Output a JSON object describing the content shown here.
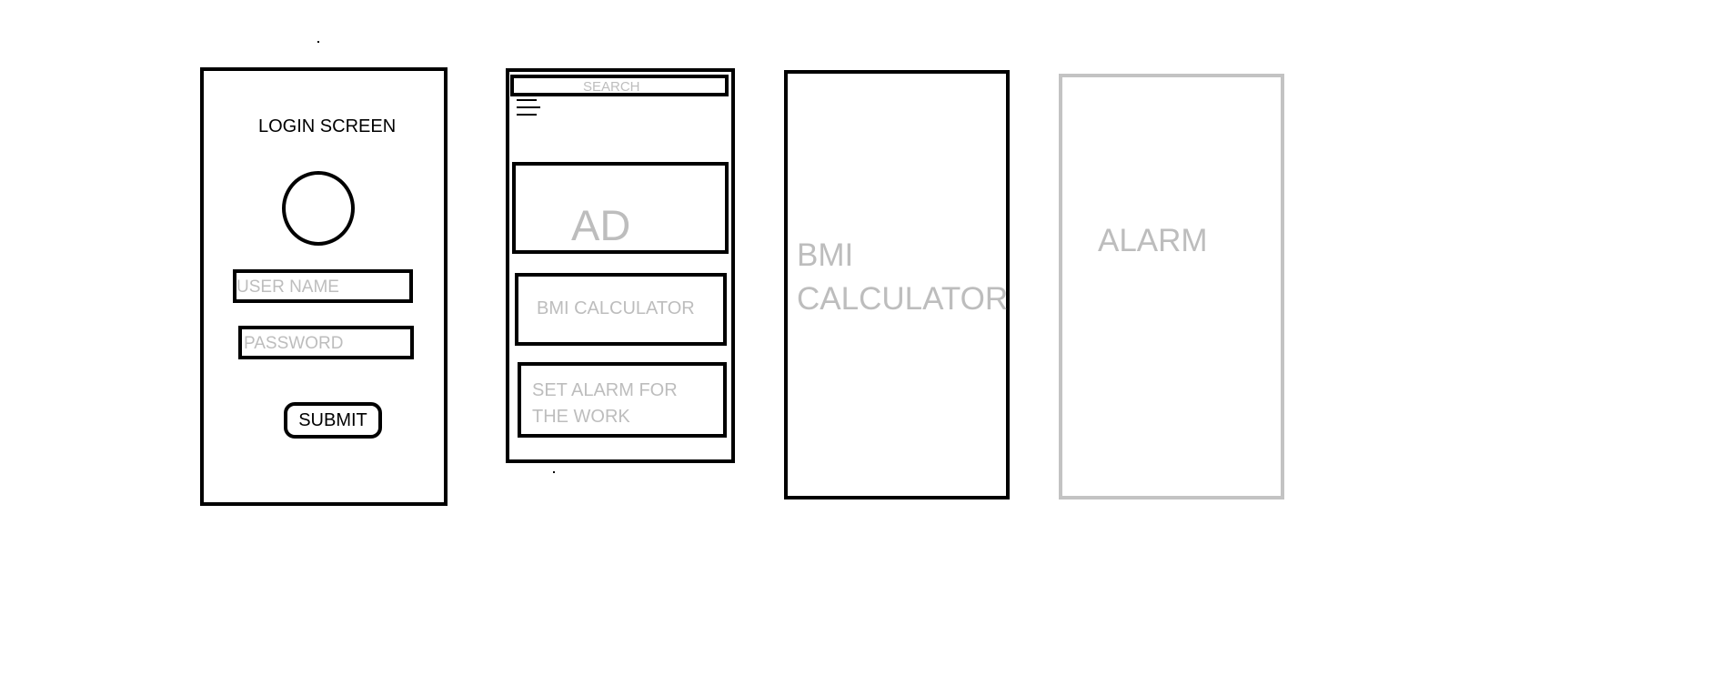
{
  "login_screen": {
    "title": "LOGIN SCREEN",
    "username_placeholder": "USER NAME",
    "password_placeholder": "PASSWORD",
    "submit_label": "SUBMIT"
  },
  "home_screen": {
    "search_placeholder": "SEARCH",
    "menu_icon": "hamburger-menu-icon",
    "ad_label": "AD",
    "bmi_card_label": "BMI CALCULATOR",
    "alarm_card_line1": "SET ALARM FOR",
    "alarm_card_line2": "THE WORK"
  },
  "bmi_screen": {
    "title_line1": "BMI",
    "title_line2": "CALCULATOR"
  },
  "alarm_screen": {
    "title": "ALARM"
  },
  "colors": {
    "stroke": "#000000",
    "placeholder_text": "#bdbdbd",
    "light_frame": "#c3c3c3"
  }
}
